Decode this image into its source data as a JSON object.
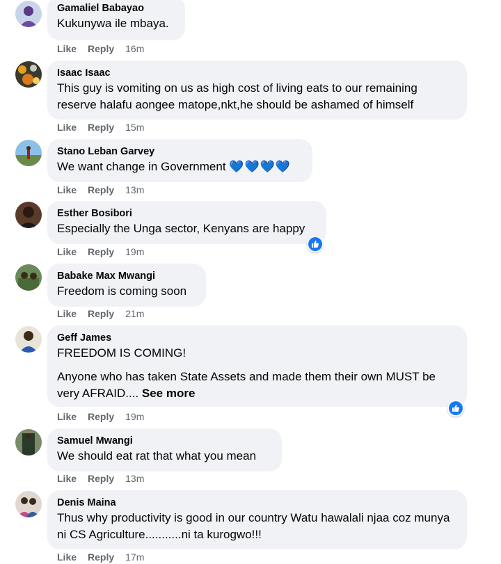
{
  "actions": {
    "like": "Like",
    "reply": "Reply"
  },
  "colors": {
    "bubble": "#f0f2f5",
    "meta": "#65676b",
    "like_blue": "#1877f2",
    "heart": "#4aa6e8"
  },
  "comments": [
    {
      "author": "Gamaliel Babayao",
      "lines": [
        "Kukunywa ile mbaya."
      ],
      "time": "16m"
    },
    {
      "author": "Isaac Isaac",
      "lines": [
        "This guy is vomiting on us as high cost of living eats to our remaining reserve halafu aongee matope,nkt,he should be ashamed of himself"
      ],
      "time": "15m"
    },
    {
      "author": "Stano Leban Garvey",
      "lines": [
        "We want change in Government"
      ],
      "emoji": "💙💙💙💙",
      "time": "13m"
    },
    {
      "author": "Esther Bosibori",
      "lines": [
        "Especially the Unga sector, Kenyans are happy"
      ],
      "time": "19m",
      "reaction": "like-reaction-icon"
    },
    {
      "author": "Babake Max Mwangi",
      "lines": [
        "Freedom is coming soon"
      ],
      "time": "21m"
    },
    {
      "author": "Geff James",
      "lines": [
        "FREEDOM IS COMING!",
        "Anyone who has taken State Assets and made them their own MUST be very AFRAID...."
      ],
      "see_more": "See more",
      "time": "19m",
      "reaction": "like-reaction-icon"
    },
    {
      "author": "Samuel Mwangi",
      "lines": [
        "We should eat rat that what you mean"
      ],
      "time": "13m"
    },
    {
      "author": "Denis Maina",
      "lines": [
        "Thus why productivity is good in our country Watu hawalali njaa coz munya ni CS Agriculture...........ni ta kurogwo!!!"
      ],
      "time": "17m"
    }
  ]
}
